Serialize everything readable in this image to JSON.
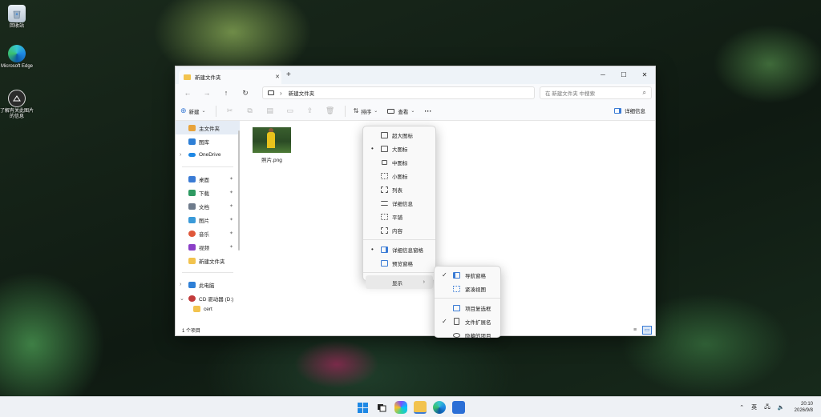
{
  "desktop": {
    "icons": [
      {
        "label": "回收站",
        "icon": "recycle-bin-icon"
      },
      {
        "label": "Microsoft Edge",
        "icon": "edge-icon"
      },
      {
        "label": "了解有关此图片的信息",
        "icon": "info-icon"
      }
    ]
  },
  "window": {
    "tab_title": "新建文件夹",
    "new_tab": "+",
    "controls": {
      "minimize": "─",
      "maximize": "☐",
      "close": "✕"
    },
    "nav": {
      "back": "←",
      "forward": "→",
      "up": "↑",
      "refresh": "↻"
    },
    "address": {
      "separator": "›",
      "path": "新建文件夹"
    },
    "search": {
      "placeholder": "在 新建文件夹 中搜索",
      "icon": "⌕"
    }
  },
  "toolbar": {
    "new_label": "新建",
    "sort_label": "排序",
    "view_label": "查看",
    "more": "···",
    "details_label": "详细信息"
  },
  "sidebar": {
    "home": "主文件夹",
    "gallery": "图库",
    "onedrive": "OneDrive",
    "quick": [
      {
        "label": "桌面",
        "color": "#3a7bd5"
      },
      {
        "label": "下载",
        "color": "#2e9a62"
      },
      {
        "label": "文档",
        "color": "#6e7b8c"
      },
      {
        "label": "图片",
        "color": "#3a9ad9"
      },
      {
        "label": "音乐",
        "color": "#e0573a"
      },
      {
        "label": "视频",
        "color": "#8b3fc7"
      },
      {
        "label": "新建文件夹",
        "color": "#f2c34e"
      }
    ],
    "this_pc": "此电脑",
    "cd_drive": "CD 驱动器 (D:)",
    "cert": "cert"
  },
  "files": [
    {
      "name": "照片.png"
    }
  ],
  "statusbar": {
    "count": "1 个项目"
  },
  "view_menu": {
    "items": [
      {
        "label": "超大图标",
        "selected": false
      },
      {
        "label": "大图标",
        "selected": true
      },
      {
        "label": "中图标",
        "selected": false
      },
      {
        "label": "小图标",
        "selected": false
      },
      {
        "label": "列表",
        "selected": false
      },
      {
        "label": "详细信息",
        "selected": false
      },
      {
        "label": "平铺",
        "selected": false
      },
      {
        "label": "内容",
        "selected": false
      }
    ],
    "panes": [
      {
        "label": "详细信息窗格",
        "selected": true
      },
      {
        "label": "预览窗格",
        "selected": false
      }
    ],
    "show_label": "显示"
  },
  "show_menu": {
    "items": [
      {
        "label": "导航窗格",
        "checked": true
      },
      {
        "label": "紧凑视图",
        "checked": false
      },
      {
        "label": "项目复选框",
        "checked": false
      },
      {
        "label": "文件扩展名",
        "checked": true
      },
      {
        "label": "隐藏的项目",
        "checked": false
      }
    ]
  },
  "taskbar": {
    "ime": "英",
    "time": "20:10",
    "date": "2026/9/8"
  }
}
